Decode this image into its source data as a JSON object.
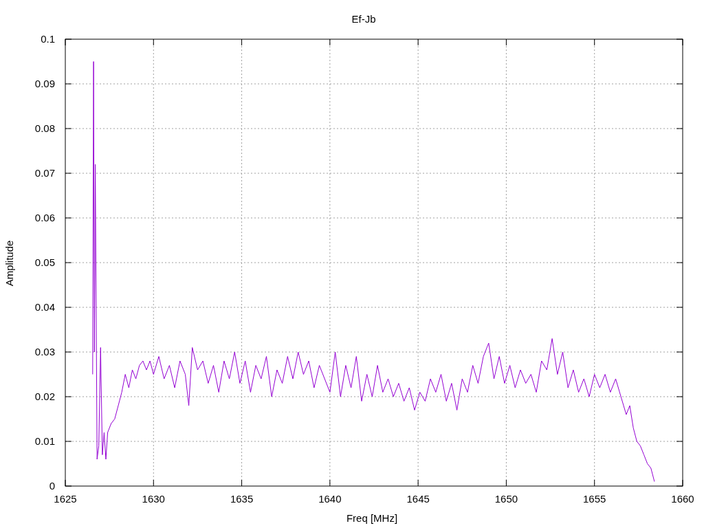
{
  "chart_data": {
    "type": "line",
    "grid": true,
    "title": "Ef-Jb",
    "xlabel": "Freq [MHz]",
    "ylabel": "Amplitude",
    "xlim": [
      1625,
      1660
    ],
    "ylim": [
      0,
      0.1
    ],
    "xticks": [
      1625,
      1630,
      1635,
      1640,
      1645,
      1650,
      1655,
      1660
    ],
    "yticks": [
      0,
      0.01,
      0.02,
      0.03,
      0.04,
      0.05,
      0.06,
      0.07,
      0.08,
      0.09,
      0.1
    ],
    "x": [
      1626.55,
      1626.6,
      1626.65,
      1626.7,
      1626.8,
      1626.9,
      1627.0,
      1627.1,
      1627.2,
      1627.3,
      1627.4,
      1627.6,
      1627.8,
      1628.0,
      1628.2,
      1628.4,
      1628.6,
      1628.8,
      1629.0,
      1629.2,
      1629.4,
      1629.6,
      1629.8,
      1630.0,
      1630.3,
      1630.6,
      1630.9,
      1631.2,
      1631.5,
      1631.8,
      1632.0,
      1632.2,
      1632.5,
      1632.8,
      1633.1,
      1633.4,
      1633.7,
      1634.0,
      1634.3,
      1634.6,
      1634.9,
      1635.2,
      1635.5,
      1635.8,
      1636.1,
      1636.4,
      1636.7,
      1637.0,
      1637.3,
      1637.6,
      1637.9,
      1638.2,
      1638.5,
      1638.8,
      1639.1,
      1639.4,
      1639.7,
      1640.0,
      1640.3,
      1640.6,
      1640.9,
      1641.2,
      1641.5,
      1641.8,
      1642.1,
      1642.4,
      1642.7,
      1643.0,
      1643.3,
      1643.6,
      1643.9,
      1644.2,
      1644.5,
      1644.8,
      1645.1,
      1645.4,
      1645.7,
      1646.0,
      1646.3,
      1646.6,
      1646.9,
      1647.2,
      1647.5,
      1647.8,
      1648.1,
      1648.4,
      1648.7,
      1649.0,
      1649.3,
      1649.6,
      1649.9,
      1650.2,
      1650.5,
      1650.8,
      1651.1,
      1651.4,
      1651.7,
      1652.0,
      1652.3,
      1652.6,
      1652.9,
      1653.2,
      1653.5,
      1653.8,
      1654.1,
      1654.4,
      1654.7,
      1655.0,
      1655.3,
      1655.6,
      1655.9,
      1656.2,
      1656.5,
      1656.8,
      1657.0,
      1657.2,
      1657.4,
      1657.6,
      1657.8,
      1658.0,
      1658.2,
      1658.4
    ],
    "series": [
      {
        "color": "#9400d3",
        "values": [
          0.025,
          0.095,
          0.03,
          0.072,
          0.006,
          0.009,
          0.031,
          0.007,
          0.012,
          0.006,
          0.012,
          0.014,
          0.015,
          0.018,
          0.021,
          0.025,
          0.022,
          0.026,
          0.024,
          0.027,
          0.028,
          0.026,
          0.028,
          0.025,
          0.029,
          0.024,
          0.027,
          0.022,
          0.028,
          0.025,
          0.018,
          0.031,
          0.026,
          0.028,
          0.023,
          0.027,
          0.021,
          0.028,
          0.024,
          0.03,
          0.023,
          0.028,
          0.021,
          0.027,
          0.024,
          0.029,
          0.02,
          0.026,
          0.023,
          0.029,
          0.024,
          0.03,
          0.025,
          0.028,
          0.022,
          0.027,
          0.024,
          0.021,
          0.03,
          0.02,
          0.027,
          0.022,
          0.029,
          0.019,
          0.025,
          0.02,
          0.027,
          0.021,
          0.024,
          0.02,
          0.023,
          0.019,
          0.022,
          0.017,
          0.021,
          0.019,
          0.024,
          0.021,
          0.025,
          0.019,
          0.023,
          0.017,
          0.024,
          0.021,
          0.027,
          0.023,
          0.029,
          0.032,
          0.024,
          0.029,
          0.023,
          0.027,
          0.022,
          0.026,
          0.023,
          0.025,
          0.021,
          0.028,
          0.026,
          0.033,
          0.025,
          0.03,
          0.022,
          0.026,
          0.021,
          0.024,
          0.02,
          0.025,
          0.022,
          0.025,
          0.021,
          0.024,
          0.02,
          0.016,
          0.018,
          0.013,
          0.01,
          0.009,
          0.007,
          0.005,
          0.004,
          0.001
        ]
      }
    ]
  }
}
